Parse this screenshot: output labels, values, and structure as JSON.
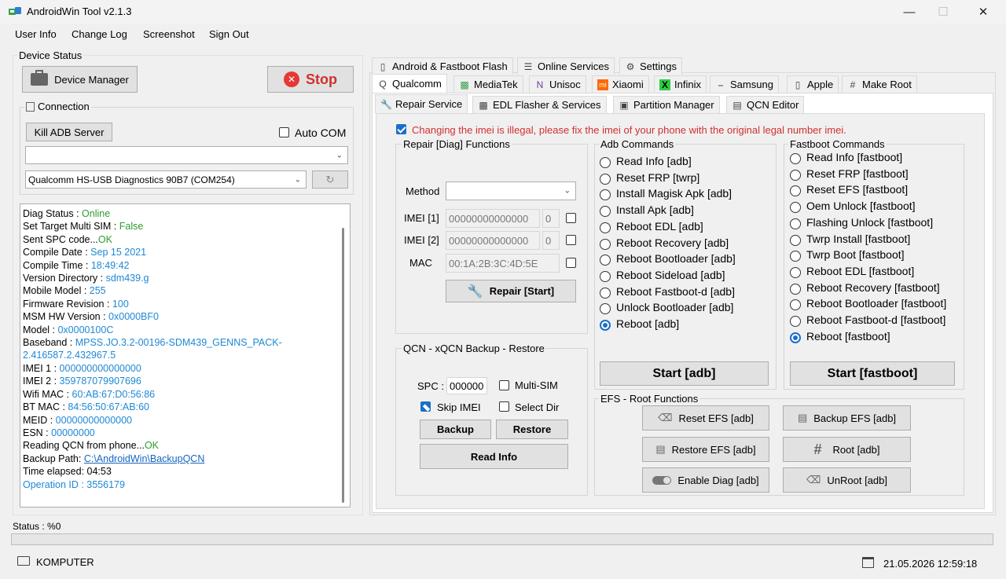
{
  "window": {
    "title": "AndroidWin Tool v2.1.3"
  },
  "menu": [
    "User Info",
    "Change Log",
    "Screenshot",
    "Sign Out"
  ],
  "device_status": {
    "label": "Device Status",
    "device_manager": "Device Manager",
    "stop": "Stop",
    "connection_label": "Connection",
    "kill_adb": "Kill ADB Server",
    "auto_com": "Auto COM",
    "port_combo": "",
    "device_combo": "Qualcomm HS-USB Diagnostics 90B7 (COM254)"
  },
  "log": [
    {
      "k": "Diag Status : ",
      "v": "Online",
      "c": "green"
    },
    {
      "k": "Set Target Multi SIM : ",
      "v": "False",
      "c": "green"
    },
    {
      "k": "Sent SPC code...",
      "v": "OK",
      "c": "green"
    },
    {
      "k": "Compile Date : ",
      "v": "Sep 15 2021",
      "c": "blue"
    },
    {
      "k": "Compile Time : ",
      "v": "18:49:42",
      "c": "blue"
    },
    {
      "k": "Version Directory : ",
      "v": "sdm439.g",
      "c": "blue"
    },
    {
      "k": "Mobile Model : ",
      "v": "255",
      "c": "blue"
    },
    {
      "k": "Firmware Revision : ",
      "v": "100",
      "c": "blue"
    },
    {
      "k": "MSM HW Version : ",
      "v": "0x0000BF0",
      "c": "blue"
    },
    {
      "k": "Model : ",
      "v": "0x0000100C",
      "c": "blue"
    },
    {
      "k": "Baseband : ",
      "v": "MPSS.JO.3.2-00196-SDM439_GENNS_PACK-",
      "c": "blue"
    },
    {
      "k": "",
      "v": "2.416587.2.432967.5",
      "c": "blue"
    },
    {
      "k": "IMEI 1 : ",
      "v": "000000000000000",
      "c": "blue"
    },
    {
      "k": "IMEI 2 : ",
      "v": "359787079907696",
      "c": "blue"
    },
    {
      "k": "Wifi MAC : ",
      "v": "60:AB:67:D0:56:86",
      "c": "blue"
    },
    {
      "k": "BT MAC : ",
      "v": "84:56:50:67:AB:60",
      "c": "blue"
    },
    {
      "k": "MEID : ",
      "v": "00000000000000",
      "c": "blue"
    },
    {
      "k": "ESN : ",
      "v": "00000000",
      "c": "blue"
    },
    {
      "k": "Reading QCN from phone...",
      "v": "OK",
      "c": "green"
    },
    {
      "k": "Backup Path: ",
      "v": "C:\\AndroidWin\\BackupQCN",
      "c": "link"
    },
    {
      "k": "Time elapsed: ",
      "v": "04:53",
      "c": ""
    },
    {
      "k": "",
      "v": "Operation ID : 3556179",
      "c": "blue"
    }
  ],
  "tabs_row1": [
    "Android & Fastboot Flash",
    "Online Services",
    "Settings"
  ],
  "tabs_row2": [
    "Qualcomm",
    "MediaTek",
    "Unisoc",
    "Xiaomi",
    "Infinix",
    "Samsung",
    "Apple",
    "Make Root"
  ],
  "tabs_row3": [
    "Repair Service",
    "EDL Flasher & Services",
    "Partition Manager",
    "QCN Editor"
  ],
  "warning": "Changing the imei is illegal, please fix the imei of your phone with the original legal number imei.",
  "repair": {
    "label": "Repair [Diag] Functions",
    "method_label": "Method",
    "method_value": "",
    "imei1_label": "IMEI [1]",
    "imei1_value": "00000000000000",
    "imei1_check": "0",
    "imei2_label": "IMEI [2]",
    "imei2_value": "00000000000000",
    "imei2_check": "0",
    "mac_label": "MAC",
    "mac_value": "00:1A:2B:3C:4D:5E",
    "start": "Repair [Start]"
  },
  "qcn": {
    "label": "QCN - xQCN Backup - Restore",
    "spc_label": "SPC :",
    "spc_value": "000000",
    "multi_sim": "Multi-SIM",
    "skip_imei": "Skip IMEI",
    "select_dir": "Select Dir",
    "backup": "Backup",
    "restore": "Restore",
    "read_info": "Read Info"
  },
  "adb": {
    "label": "Adb Commands",
    "items": [
      "Read Info [adb]",
      "Reset FRP [twrp]",
      "Install Magisk Apk [adb]",
      "Install Apk [adb]",
      "Reboot EDL [adb]",
      "Reboot Recovery [adb]",
      "Reboot Bootloader [adb]",
      "Reboot Sideload [adb]",
      "Reboot Fastboot-d [adb]",
      "Unlock Bootloader [adb]",
      "Reboot [adb]"
    ],
    "selected": 10,
    "start": "Start [adb]"
  },
  "fastboot": {
    "label": "Fastboot Commands",
    "items": [
      "Read Info [fastboot]",
      "Reset FRP [fastboot]",
      "Reset EFS [fastboot]",
      "Oem Unlock [fastboot]",
      "Flashing Unlock [fastboot]",
      "Twrp Install [fastboot]",
      "Twrp Boot [fastboot]",
      "Reboot EDL [fastboot]",
      "Reboot Recovery [fastboot]",
      "Reboot Bootloader [fastboot]",
      "Reboot Fastboot-d [fastboot]",
      "Reboot [fastboot]"
    ],
    "selected": 11,
    "start": "Start [fastboot]"
  },
  "efs": {
    "label": "EFS - Root Functions",
    "reset_efs": "Reset EFS [adb]",
    "backup_efs": "Backup EFS [adb]",
    "restore_efs": "Restore EFS [adb]",
    "root": "Root [adb]",
    "enable_diag": "Enable Diag [adb]",
    "unroot": "UnRoot [adb]"
  },
  "status": {
    "label": "Status : %0",
    "progress": 0
  },
  "footer": {
    "computer": "KOMPUTER",
    "datetime": "21.05.2026 12:59:18"
  }
}
